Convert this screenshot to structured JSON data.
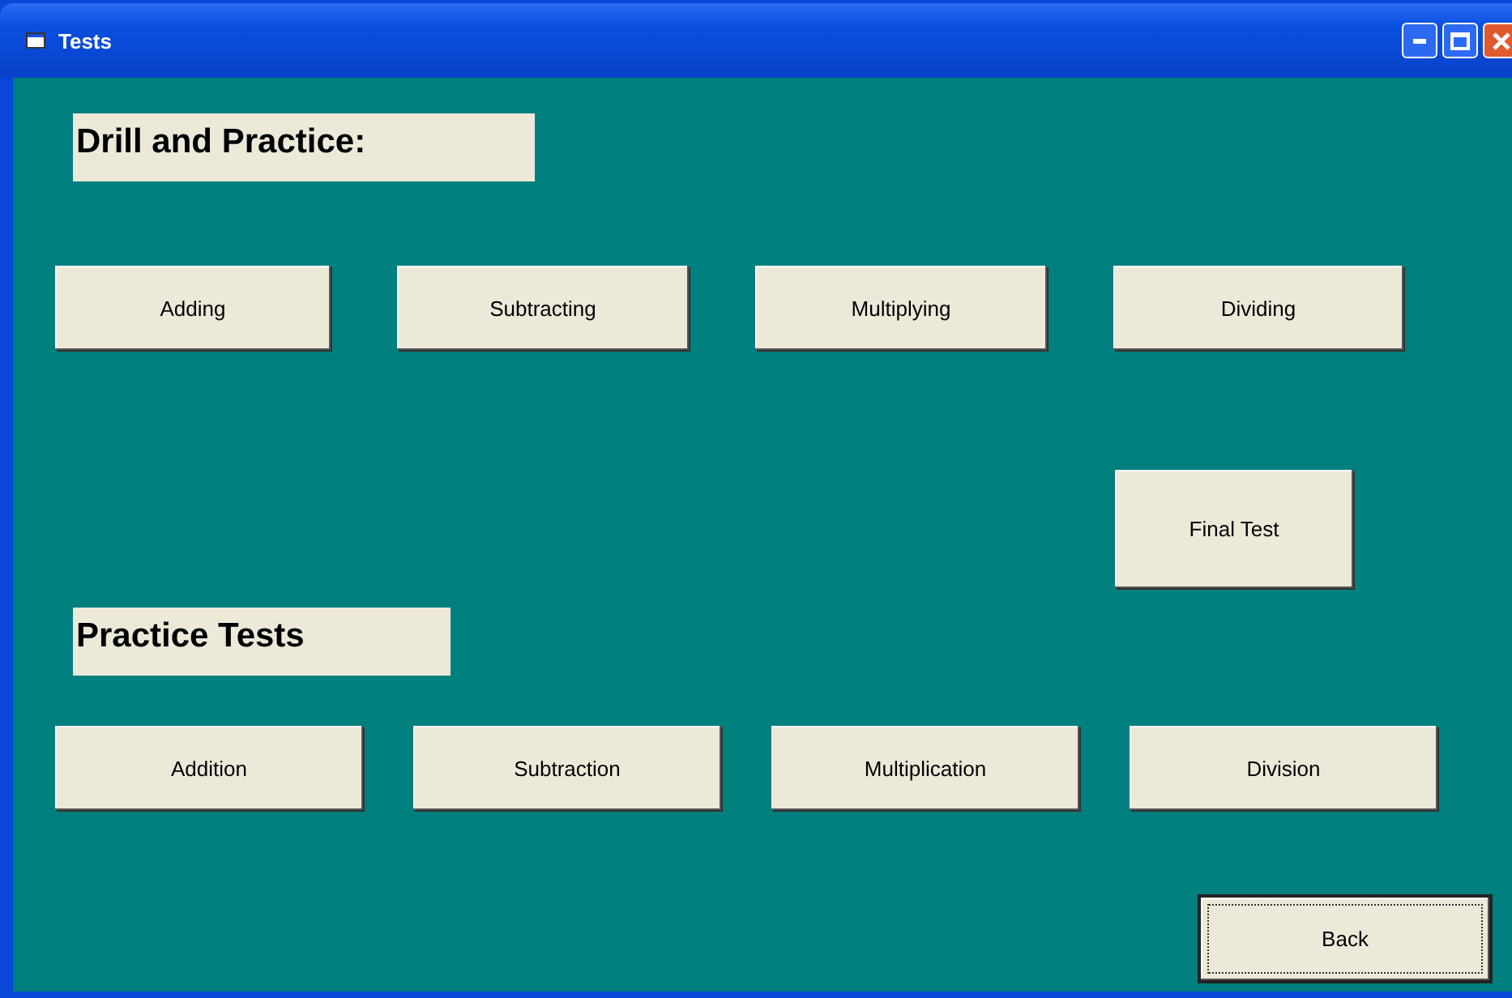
{
  "window": {
    "title": "Tests"
  },
  "drill": {
    "heading": "Drill and Practice:",
    "buttons": [
      {
        "label": "Adding"
      },
      {
        "label": "Subtracting"
      },
      {
        "label": "Multiplying"
      },
      {
        "label": "Dividing"
      }
    ]
  },
  "final_test": {
    "label": "Final Test"
  },
  "practice": {
    "heading": "Practice Tests",
    "buttons": [
      {
        "label": "Addition"
      },
      {
        "label": "Subtraction"
      },
      {
        "label": "Multiplication"
      },
      {
        "label": "Division"
      }
    ]
  },
  "back": {
    "label": "Back",
    "focused": true
  }
}
